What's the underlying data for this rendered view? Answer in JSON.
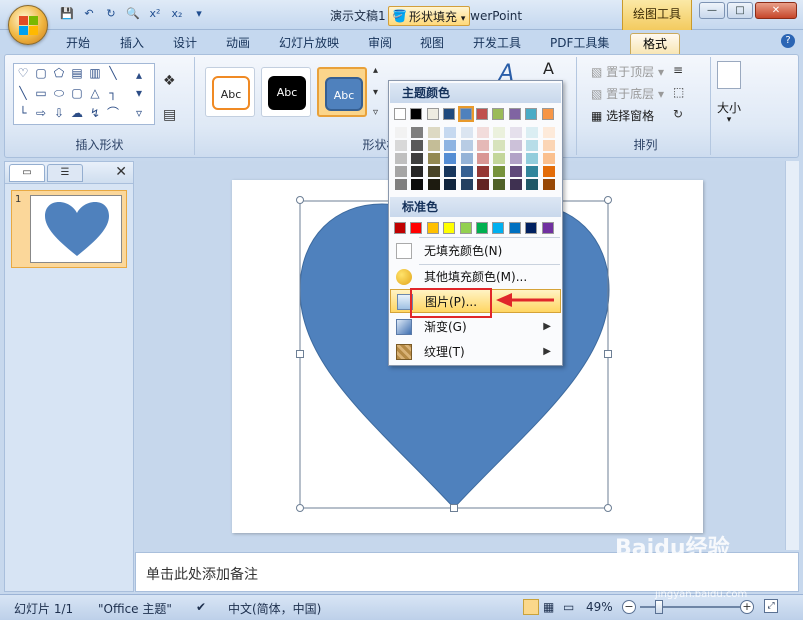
{
  "titlebar": {
    "window_title": "演示文稿1 - Microsoft PowerPoint",
    "contextual_tab_group": "绘图工具",
    "qat_icons": [
      "save-icon",
      "undo-icon",
      "redo-icon",
      "print-preview-icon",
      "superscript-icon",
      "subscript-icon",
      "customize-qat-icon"
    ],
    "qat_glyphs": {
      "superscript": "x²",
      "subscript": "x₂"
    }
  },
  "tabs": [
    {
      "label": "开始"
    },
    {
      "label": "插入"
    },
    {
      "label": "设计"
    },
    {
      "label": "动画"
    },
    {
      "label": "幻灯片放映"
    },
    {
      "label": "审阅"
    },
    {
      "label": "视图"
    },
    {
      "label": "开发工具"
    },
    {
      "label": "PDF工具集"
    },
    {
      "label": "格式",
      "active": true
    }
  ],
  "ribbon": {
    "groups": {
      "insert_shapes": "插入形状",
      "shape_styles": "形状样式",
      "arrange": "排列"
    },
    "style_thumbs": [
      "Abc",
      "Abc",
      "Abc"
    ],
    "shape_fill_button": "形状填充",
    "arrange_items": [
      "置于顶层",
      "置于底层",
      "选择窗格"
    ],
    "size_label": "大小"
  },
  "fill_dropdown": {
    "theme_colors_header": "主题颜色",
    "standard_colors_header": "标准色",
    "theme_top_row": [
      "#ffffff",
      "#000000",
      "#eeece1",
      "#1f497d",
      "#4f81bd",
      "#c0504d",
      "#9bbb59",
      "#8064a2",
      "#4bacc6",
      "#f79646"
    ],
    "theme_shades": [
      [
        "#f2f2f2",
        "#7f7f7f",
        "#ddd9c3",
        "#c6d9f0",
        "#dbe5f1",
        "#f2dcdb",
        "#ebf1dd",
        "#e5e0ec",
        "#dbeef3",
        "#fdeada"
      ],
      [
        "#d8d8d8",
        "#595959",
        "#c4bd97",
        "#8db3e2",
        "#b8cce4",
        "#e5b9b7",
        "#d7e3bc",
        "#ccc1d9",
        "#b7dde8",
        "#fbd5b5"
      ],
      [
        "#bfbfbf",
        "#3f3f3f",
        "#938953",
        "#548dd4",
        "#95b3d7",
        "#d99694",
        "#c3d69b",
        "#b2a2c7",
        "#92cddc",
        "#fac08f"
      ],
      [
        "#a5a5a5",
        "#262626",
        "#494429",
        "#17365d",
        "#366092",
        "#953734",
        "#76923c",
        "#5f497a",
        "#31859b",
        "#e36c09"
      ],
      [
        "#7f7f7f",
        "#0c0c0c",
        "#1d1b10",
        "#0f243e",
        "#244061",
        "#632423",
        "#4f6128",
        "#3f3151",
        "#205867",
        "#974806"
      ]
    ],
    "standard_colors": [
      "#c00000",
      "#ff0000",
      "#ffc000",
      "#ffff00",
      "#92d050",
      "#00b050",
      "#00b0f0",
      "#0070c0",
      "#002060",
      "#7030a0"
    ],
    "items": [
      {
        "label": "无填充颜色(N)",
        "icon": "no-fill-icon"
      },
      {
        "label": "其他填充颜色(M)...",
        "icon": "more-colors-icon"
      },
      {
        "label": "图片(P)...",
        "icon": "picture-icon",
        "highlighted": true
      },
      {
        "label": "渐变(G)",
        "icon": "gradient-icon",
        "submenu": true
      },
      {
        "label": "纹理(T)",
        "icon": "texture-icon",
        "submenu": true
      }
    ]
  },
  "slide_pane": {
    "slide_number": "1"
  },
  "slide": {
    "heart_color": "#4f81bd"
  },
  "notes": {
    "placeholder": "单击此处添加备注"
  },
  "statusbar": {
    "slide_info": "幻灯片 1/1",
    "theme": "\"Office 主题\"",
    "language": "中文(简体，中国)",
    "zoom": "49%"
  },
  "watermark": {
    "text": "Baidu经验",
    "sub": "jingyan.baidu.com"
  }
}
